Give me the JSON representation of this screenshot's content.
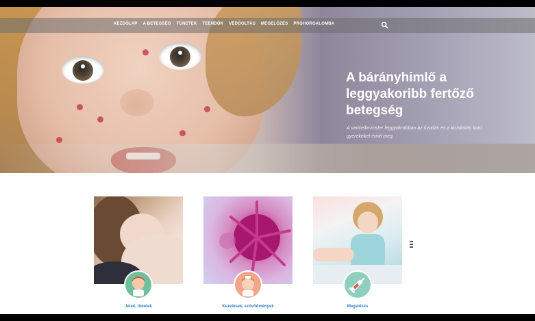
{
  "nav": {
    "items": [
      "Kezdőlap",
      "A betegség",
      "Tünetek",
      "Teendők",
      "Védőoltás",
      "Megelőzés",
      "Prohorgalomba"
    ],
    "search_icon": "search-icon"
  },
  "hero": {
    "title": "A bárányhimlő a leggyakoribb fertőző betegség",
    "subtitle": "A varicella-zoster leggyakrabban az óvodás és a kisiskolás korú gyerekeket érinti meg."
  },
  "cards": [
    {
      "label": "Jelek, tünetek",
      "badge_icon": "doctor-icon",
      "color": "#6fbf9b"
    },
    {
      "label": "Kezelések, szövődmények",
      "badge_icon": "nurse-icon",
      "color": "#f2a58c"
    },
    {
      "label": "Megelőzés",
      "badge_icon": "syringe-icon",
      "color": "#8fcfbf"
    }
  ],
  "colors": {
    "link": "#2e7fc9",
    "nav_bg": "#6e6e6e"
  }
}
